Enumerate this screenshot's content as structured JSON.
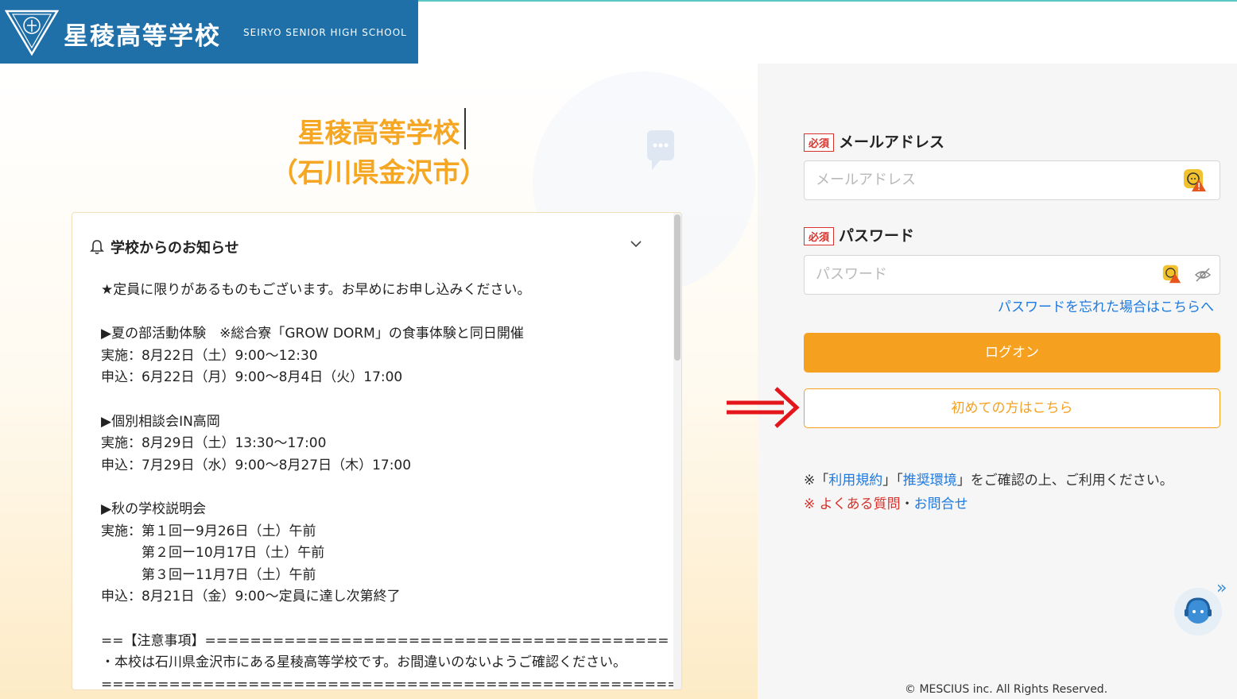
{
  "header": {
    "school_name": "星稜高等学校",
    "school_name_en": "SEIRYO SENIOR HIGH SCHOOL"
  },
  "main": {
    "title_line1": "星稜高等学校",
    "title_line2": "（石川県金沢市）"
  },
  "notice": {
    "heading": "学校からのお知らせ",
    "body": "★定員に限りがあるものもございます。お早めにお申し込みください。\n\n▶夏の部活動体験　※総合寮「GROW DORM」の食事体験と同日開催\n実施：8月22日（土）9:00～12:30\n申込：6月22日（月）9:00～8月4日（火）17:00\n\n▶個別相談会IN高岡\n実施：8月29日（土）13:30～17:00\n申込：7月29日（水）9:00～8月27日（木）17:00\n\n▶秋の学校説明会\n実施：第１回ー9月26日（土）午前\n　　　第２回ー10月17日（土）午前\n　　　第３回ー11月7日（土）午前\n申込：8月21日（金）9:00～定員に達し次第終了\n\n==【注意事項】=========================================\n・本校は石川県金沢市にある星稜高等学校です。お間違いのないようご確認ください。\n===================================================="
  },
  "login": {
    "required_badge": "必須",
    "email_label": "メールアドレス",
    "email_placeholder": "メールアドレス",
    "password_label": "パスワード",
    "password_placeholder": "パスワード",
    "forgot_link": "パスワードを忘れた場合はこちらへ",
    "login_button": "ログオン",
    "first_time_button": "初めての方はこちら"
  },
  "links": {
    "prefix": "※「",
    "terms": "利用規約",
    "mid": "」「",
    "env": "推奨環境",
    "suffix": "」をご確認の上、ご利用ください。",
    "faq_prefix": "※ ",
    "faq": "よくある質問",
    "sep": "・",
    "contact": "お問合せ"
  },
  "support": {
    "chevron": "»"
  },
  "footer": {
    "copyright": "© MESCIUS inc. All Rights Reserved."
  },
  "colors": {
    "accent": "#f5a01f",
    "brand": "#1f6fa8",
    "link": "#1d7ae0",
    "required": "#d9312b"
  }
}
